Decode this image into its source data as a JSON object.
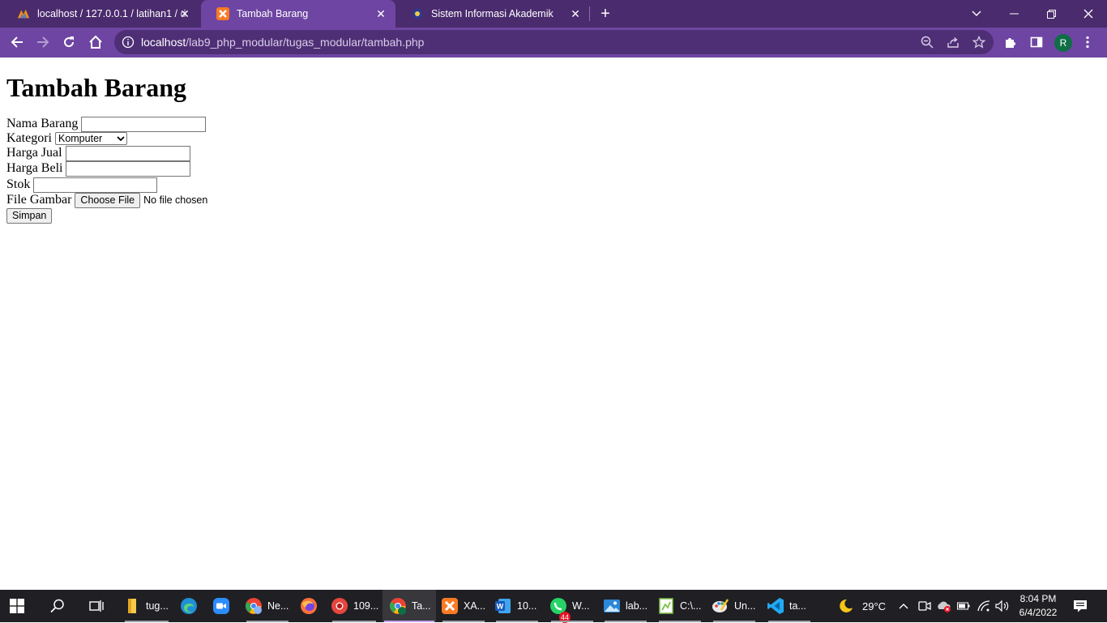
{
  "browser": {
    "tabs": [
      {
        "title": "localhost / 127.0.0.1 / latihan1 / d",
        "active": false
      },
      {
        "title": "Tambah Barang",
        "active": true
      },
      {
        "title": "Sistem Informasi Akademik",
        "active": false
      }
    ],
    "url_host": "localhost",
    "url_path": "/lab9_php_modular/tugas_modular/tambah.php",
    "profile_initial": "R",
    "accent_color": "#6e45a2"
  },
  "page": {
    "heading": "Tambah Barang",
    "form": {
      "nama_label": "Nama Barang",
      "nama_value": "",
      "kategori_label": "Kategori",
      "kategori_selected": "Komputer",
      "harga_jual_label": "Harga Jual",
      "harga_jual_value": "",
      "harga_beli_label": "Harga Beli",
      "harga_beli_value": "",
      "stok_label": "Stok",
      "stok_value": "",
      "gambar_label": "File Gambar",
      "choose_file_label": "Choose File",
      "no_file_text": "No file chosen",
      "submit_label": "Simpan"
    }
  },
  "taskbar": {
    "apps": [
      {
        "label": "tug...",
        "icon": "folder-icon"
      },
      {
        "label": "",
        "icon": "edge-icon"
      },
      {
        "label": "",
        "icon": "zoom-icon"
      },
      {
        "label": "Ne...",
        "icon": "chrome-profile-icon"
      },
      {
        "label": "",
        "icon": "firefox-icon"
      },
      {
        "label": "109...",
        "icon": "chrome-red-icon"
      },
      {
        "label": "Ta...",
        "icon": "chrome-icon"
      },
      {
        "label": "XA...",
        "icon": "xampp-icon"
      },
      {
        "label": "10...",
        "icon": "word-icon"
      },
      {
        "label": "W...",
        "icon": "whatsapp-icon",
        "badge": "44"
      },
      {
        "label": "lab...",
        "icon": "photos-icon"
      },
      {
        "label": "C:\\...",
        "icon": "notepad-icon"
      },
      {
        "label": "Un...",
        "icon": "paint-icon"
      },
      {
        "label": "ta...",
        "icon": "vscode-icon"
      }
    ],
    "temperature": "29°C",
    "time": "8:04 PM",
    "date": "6/4/2022"
  }
}
